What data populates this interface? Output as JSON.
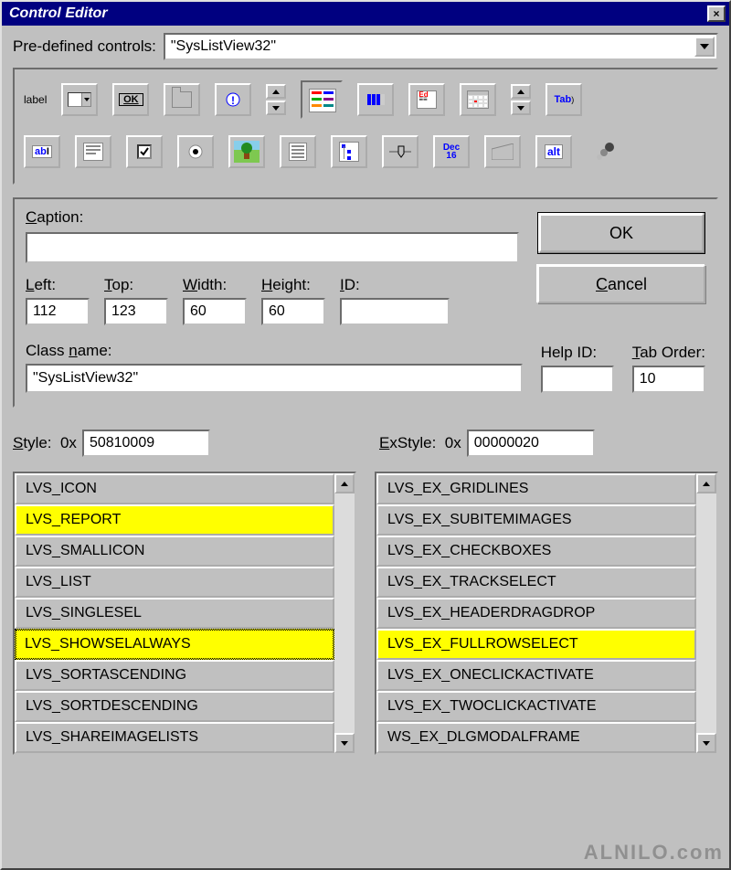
{
  "window": {
    "title": "Control Editor"
  },
  "predefined": {
    "label": "Pre-defined controls:",
    "value": "\"SysListView32\""
  },
  "toolbox": {
    "row1": [
      "label",
      "combo",
      "OK",
      "tab-pane",
      "info",
      "updown",
      "listview",
      "progress",
      "richedit",
      "month-cal",
      "spin2",
      "tab"
    ],
    "row2": [
      "edit",
      "memo",
      "checkbox",
      "radio",
      "picture",
      "list",
      "tree",
      "slider",
      "date",
      "frame",
      "alt",
      "custom"
    ]
  },
  "caption": {
    "label": "Caption:",
    "value": ""
  },
  "buttons": {
    "ok": "OK",
    "cancel": "Cancel"
  },
  "dims": {
    "left_label": "Left:",
    "left": "112",
    "top_label": "Top:",
    "top": "123",
    "width_label": "Width:",
    "width": "60",
    "height_label": "Height:",
    "height": "60",
    "id_label": "ID:",
    "id": ""
  },
  "classname": {
    "label": "Class name:",
    "value": "\"SysListView32\""
  },
  "helpid": {
    "label": "Help ID:",
    "value": ""
  },
  "taborder": {
    "label": "Tab Order:",
    "value": "10"
  },
  "style": {
    "label": "Style:  0x",
    "value": "50810009"
  },
  "exstyle": {
    "label": "ExStyle:  0x",
    "value": "00000020"
  },
  "style_list": [
    {
      "t": "LVS_ICON",
      "sel": false
    },
    {
      "t": "LVS_REPORT",
      "sel": true
    },
    {
      "t": "LVS_SMALLICON",
      "sel": false
    },
    {
      "t": "LVS_LIST",
      "sel": false
    },
    {
      "t": "LVS_SINGLESEL",
      "sel": false
    },
    {
      "t": "LVS_SHOWSELALWAYS",
      "sel": true,
      "focus": true
    },
    {
      "t": "LVS_SORTASCENDING",
      "sel": false
    },
    {
      "t": "LVS_SORTDESCENDING",
      "sel": false
    },
    {
      "t": "LVS_SHAREIMAGELISTS",
      "sel": false
    }
  ],
  "exstyle_list": [
    {
      "t": "LVS_EX_GRIDLINES",
      "sel": false
    },
    {
      "t": "LVS_EX_SUBITEMIMAGES",
      "sel": false
    },
    {
      "t": "LVS_EX_CHECKBOXES",
      "sel": false
    },
    {
      "t": "LVS_EX_TRACKSELECT",
      "sel": false
    },
    {
      "t": "LVS_EX_HEADERDRAGDROP",
      "sel": false
    },
    {
      "t": "LVS_EX_FULLROWSELECT",
      "sel": true
    },
    {
      "t": "LVS_EX_ONECLICKACTIVATE",
      "sel": false
    },
    {
      "t": "LVS_EX_TWOCLICKACTIVATE",
      "sel": false
    },
    {
      "t": "WS_EX_DLGMODALFRAME",
      "sel": false
    }
  ],
  "watermark": "ALNILO.com"
}
